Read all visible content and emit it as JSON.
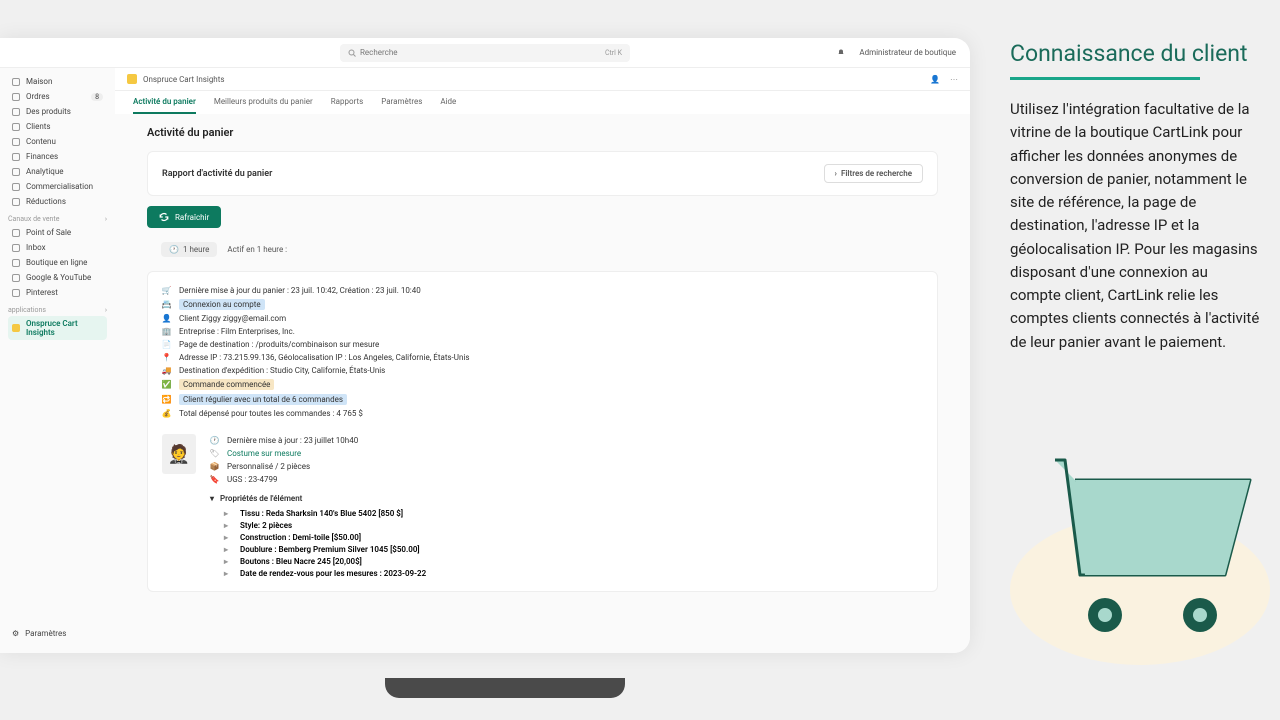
{
  "topbar": {
    "search_placeholder": "Recherche",
    "kbd": "Ctrl K",
    "admin": "Administrateur de boutique"
  },
  "sidebar": {
    "main": [
      {
        "label": "Maison"
      },
      {
        "label": "Ordres",
        "badge": "8"
      },
      {
        "label": "Des produits"
      },
      {
        "label": "Clients"
      },
      {
        "label": "Contenu"
      },
      {
        "label": "Finances"
      },
      {
        "label": "Analytique"
      },
      {
        "label": "Commercialisation"
      },
      {
        "label": "Réductions"
      }
    ],
    "channels_hd": "Canaux de vente",
    "channels": [
      {
        "label": "Point of Sale"
      },
      {
        "label": "Inbox"
      },
      {
        "label": "Boutique en ligne"
      },
      {
        "label": "Google & YouTube"
      },
      {
        "label": "Pinterest"
      }
    ],
    "apps_hd": "applications",
    "apps": [
      {
        "label": "Onspruce Cart Insights"
      }
    ],
    "settings": "Paramètres"
  },
  "app": {
    "name": "Onspruce Cart Insights"
  },
  "tabs": [
    "Activité du panier",
    "Meilleurs produits du panier",
    "Rapports",
    "Paramètres",
    "Aide"
  ],
  "page_title": "Activité du panier",
  "report": {
    "title": "Rapport d'activité du panier",
    "filters": "Filtres de recherche"
  },
  "refresh": "Rafraîchir",
  "time": {
    "badge": "1 heure",
    "text": "Actif en 1 heure :"
  },
  "rows": [
    {
      "ic": "🛒",
      "t": "Dernière mise à jour du panier : 23 juil. 10:42, Création : 23 juil. 10:40"
    },
    {
      "ic": "📇",
      "t": "Connexion au compte",
      "hl": "blue"
    },
    {
      "ic": "👤",
      "t": "Client Ziggy ziggy@email.com"
    },
    {
      "ic": "🏢",
      "t": "Entreprise : Film Enterprises, Inc."
    },
    {
      "ic": "📄",
      "t": "Page de destination : /produits/combinaison sur mesure"
    },
    {
      "ic": "📍",
      "t": "Adresse IP : 73.215.99.136, Géolocalisation IP : Los Angeles, Californie, États-Unis"
    },
    {
      "ic": "🚚",
      "t": "Destination d'expédition : Studio City, Californie, États-Unis"
    },
    {
      "ic": "✅",
      "t": "Commande commencée",
      "hl": "yel"
    },
    {
      "ic": "🔁",
      "t": "Client régulier avec un total de 6 commandes",
      "hl": "blue"
    },
    {
      "ic": "💰",
      "t": "Total dépensé pour toutes les commandes : 4 765 $"
    }
  ],
  "product": {
    "meta": [
      {
        "ic": "🕐",
        "t": "Dernière mise à jour : 23 juillet 10h40"
      },
      {
        "ic": "🏷",
        "t": "Costume sur mesure",
        "link": true
      },
      {
        "ic": "📦",
        "t": "Personnalisé / 2 pièces"
      },
      {
        "ic": "🔖",
        "t": "UGS : 23-4799"
      }
    ],
    "props_hd": "Propriétés de l'élément",
    "props": [
      "Tissu : Reda Sharksin 140's Blue 5402 [850 $]",
      "Style: 2 pièces",
      "Construction : Demi-toile [$50.00]",
      "Doublure : Bemberg Premium Silver 1045 [$50.00]",
      "Boutons : Bleu Nacre 245 [20,00$]",
      "Date de rendez-vous pour les mesures : 2023-09-22"
    ]
  },
  "right": {
    "title": "Connaissance du client",
    "text": "Utilisez l'intégration facultative de la vitrine de la boutique CartLink pour afficher les données anonymes de conversion de panier, notamment le site de référence, la page de destination, l'adresse IP et la géolocalisation IP. Pour les magasins disposant d'une connexion au compte client, CartLink relie les comptes clients connectés à l'activité de leur panier avant le paiement."
  }
}
